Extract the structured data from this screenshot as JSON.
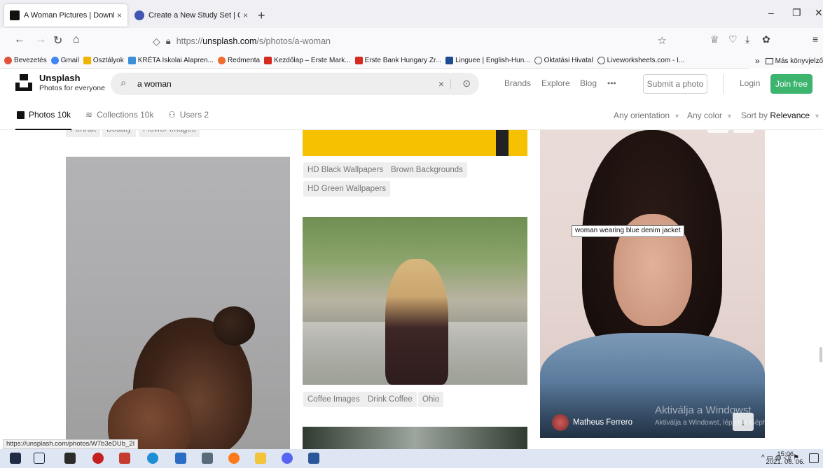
{
  "browser": {
    "tabs": [
      {
        "title": "A Woman Pictures | Download F",
        "active": true
      },
      {
        "title": "Create a New Study Set | Quizle",
        "active": false
      }
    ],
    "new_tab": "+",
    "url_prefix": "https://",
    "url_host": "unsplash.com",
    "url_path": "/s/photos/a-woman",
    "bookmarks": [
      {
        "label": "Bevezetés",
        "color": "#e2523a"
      },
      {
        "label": "Gmail",
        "color": "#4285f4"
      },
      {
        "label": "Osztályok",
        "color": "#f0b400"
      },
      {
        "label": "KRÉTA Iskolai Alapren...",
        "color": "#3a8fd6"
      },
      {
        "label": "Redmenta",
        "color": "#f06d2c"
      },
      {
        "label": "Kezdőlap – Erste Mark...",
        "color": "#d52b1e"
      },
      {
        "label": "Erste Bank Hungary Zr...",
        "color": "#d52b1e"
      },
      {
        "label": "Linguee | English-Hun...",
        "color": "#1d4c8f"
      },
      {
        "label": "Oktatási Hivatal",
        "color": "#666666"
      },
      {
        "label": "Liveworksheets.com - I...",
        "color": "#555555"
      }
    ],
    "bookmarks_overflow": "»",
    "other_bookmarks": "Más könyvjelző"
  },
  "unsplash": {
    "brand": "Unsplash",
    "tagline": "Photos for everyone",
    "search_value": "a woman",
    "nav": [
      "Brands",
      "Explore",
      "Blog",
      "•••"
    ],
    "submit": "Submit a photo",
    "login": "Login",
    "join": "Join free",
    "colors": {
      "join_bg": "#3cb46e"
    }
  },
  "filters": {
    "photos": "Photos 10k",
    "collections": "Collections 10k",
    "users": "Users 2",
    "orientation": "Any orientation",
    "color": "Any color",
    "sort_prefix": "Sort by ",
    "sort_value": "Relevance"
  },
  "content": {
    "top_chips_left": [
      "Portrait",
      "Beauty",
      "Flower Images"
    ],
    "chips_col2a": [
      "HD Black Wallpapers",
      "Brown Backgrounds",
      "HD Green Wallpapers"
    ],
    "chips_col2b": [
      "Coffee Images",
      "Drink Coffee",
      "Ohio"
    ],
    "tooltip": "woman wearing blue denim jacket",
    "author": "Matheus Ferrero",
    "watermark_title": "Aktiválja a Windowst",
    "watermark_sub": "Aktiválja a Windowst, lépjen a Gépházban.",
    "status_url": "https://unsplash.com/photos/W7b3eDUb_2I"
  },
  "taskbar": {
    "time": "15:06",
    "date": "2021. 08. 06."
  }
}
